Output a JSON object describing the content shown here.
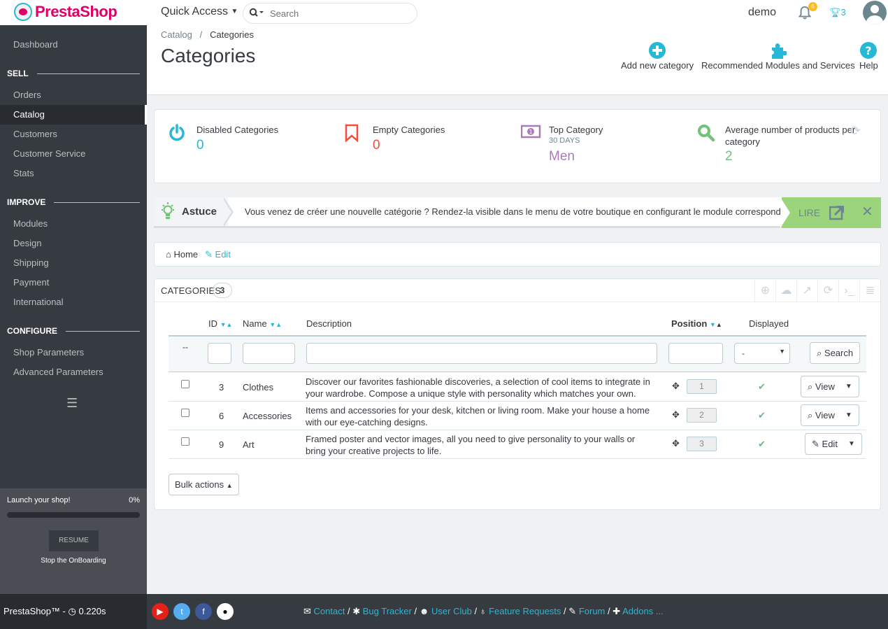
{
  "header": {
    "logo": "PrestaShop",
    "quick_access": "Quick Access",
    "search_placeholder": "Search",
    "user": "demo",
    "notifications": "6",
    "trophy_count": "3"
  },
  "sidebar": {
    "dashboard": "Dashboard",
    "sections": [
      {
        "title": "SELL",
        "items": [
          "Orders",
          "Catalog",
          "Customers",
          "Customer Service",
          "Stats"
        ]
      },
      {
        "title": "IMPROVE",
        "items": [
          "Modules",
          "Design",
          "Shipping",
          "Payment",
          "International"
        ]
      },
      {
        "title": "CONFIGURE",
        "items": [
          "Shop Parameters",
          "Advanced Parameters"
        ]
      }
    ],
    "active": "Catalog",
    "launch_label": "Launch your shop!",
    "launch_pct": "0%",
    "launch_progress": 0,
    "resume": "RESUME",
    "stop": "Stop the OnBoarding"
  },
  "page": {
    "breadcrumb_parent": "Catalog",
    "breadcrumb_sep": "/",
    "breadcrumb_current": "Categories",
    "title": "Categories",
    "toolbar": {
      "add": "Add new category",
      "modules": "Recommended Modules and Services",
      "help": "Help"
    }
  },
  "kpis": [
    {
      "label": "Disabled Categories",
      "sub": "",
      "value": "0",
      "color": "#25b9d7"
    },
    {
      "label": "Empty Categories",
      "sub": "",
      "value": "0",
      "color": "#f54c3e"
    },
    {
      "label": "Top Category",
      "sub": "30 DAYS",
      "value": "Men",
      "color": "#ab7ab8"
    },
    {
      "label": "Average number of products per",
      "label2": "category",
      "sub": "",
      "value": "2",
      "color": "#72c279"
    }
  ],
  "tip": {
    "title": "Astuce",
    "text": "Vous venez de créer une nouvelle catégorie ? Rendez-la visible dans le menu de votre boutique en configurant le module correspondant.",
    "read": "LIRE"
  },
  "home_bar": {
    "home": "Home",
    "edit": "Edit"
  },
  "categories": {
    "title": "CATEGORIES",
    "count": "3",
    "columns": {
      "id": "ID",
      "name": "Name",
      "description": "Description",
      "position": "Position",
      "displayed": "Displayed"
    },
    "filter_dash": "--",
    "filter_select": "-",
    "search_btn": "Search",
    "rows": [
      {
        "id": "3",
        "name": "Clothes",
        "description": "Discover our favorites fashionable discoveries, a selection of cool items to integrate in your wardrobe. Compose a unique style with personality which matches your own.",
        "position": "1",
        "action": "View"
      },
      {
        "id": "6",
        "name": "Accessories",
        "description": "Items and accessories for your desk, kitchen or living room. Make your house a home with our eye-catching designs.",
        "position": "2",
        "action": "View"
      },
      {
        "id": "9",
        "name": "Art",
        "description": "Framed poster and vector images, all you need to give personality to your walls or bring your creative projects to life.",
        "position": "3",
        "action": "Edit"
      }
    ],
    "bulk": "Bulk actions"
  },
  "footer": {
    "version": "PrestaShop™ - ",
    "time": "0.220s",
    "links": [
      "Contact",
      "Bug Tracker",
      "User Club",
      "Feature Requests",
      "Forum",
      "Addons ..."
    ],
    "link_sep": "/"
  },
  "colors": {
    "accent": "#25b9d7",
    "sidebar": "#363a41",
    "brand": "#df0067"
  }
}
